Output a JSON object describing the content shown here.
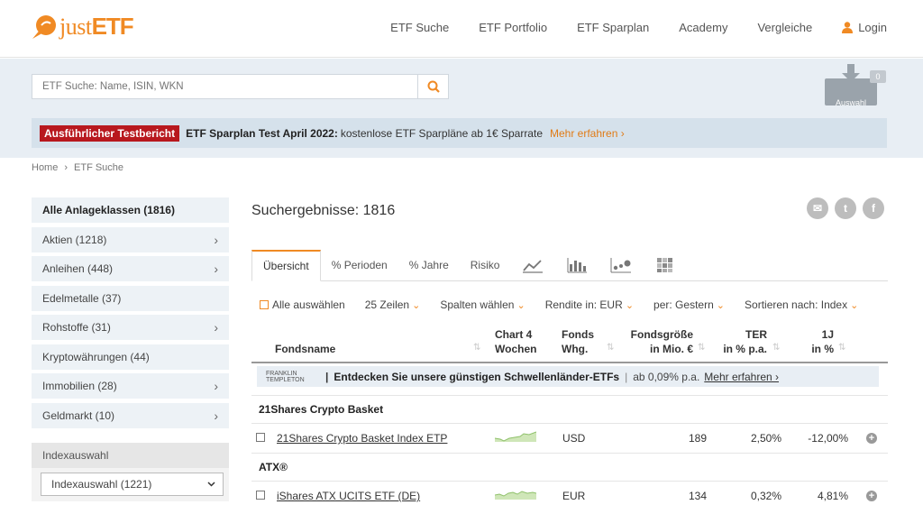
{
  "header": {
    "logo": "justETF",
    "nav": [
      "ETF Suche",
      "ETF Portfolio",
      "ETF Sparplan",
      "Academy",
      "Vergleiche"
    ],
    "login_label": "Login"
  },
  "search": {
    "placeholder": "ETF Suche: Name, ISIN, WKN"
  },
  "auswahl": {
    "label": "Auswahl",
    "count": "0"
  },
  "promo": {
    "badge": "Ausführlicher Testbericht",
    "bold": "ETF Sparplan Test April 2022:",
    "text": "kostenlose ETF Sparpläne ab 1€ Sparrate",
    "link": "Mehr erfahren ›"
  },
  "breadcrumb": [
    "Home",
    "›",
    "ETF Suche"
  ],
  "sidebar": {
    "items": [
      {
        "label": "Alle Anlageklassen (1816)",
        "chevron": ""
      },
      {
        "label": "Aktien (1218)",
        "chevron": "›"
      },
      {
        "label": "Anleihen (448)",
        "chevron": "›"
      },
      {
        "label": "Edelmetalle (37)",
        "chevron": ""
      },
      {
        "label": "Rohstoffe (31)",
        "chevron": "›"
      },
      {
        "label": "Kryptowährungen (44)",
        "chevron": ""
      },
      {
        "label": "Immobilien (28)",
        "chevron": "›"
      },
      {
        "label": "Geldmarkt (10)",
        "chevron": "›"
      }
    ],
    "index_heading": "Indexauswahl",
    "index_select": "Indexauswahl (1221)"
  },
  "results": {
    "title": "Suchergebnisse: 1816"
  },
  "tabs": [
    "Übersicht",
    "% Perioden",
    "% Jahre",
    "Risiko"
  ],
  "toolbar": {
    "select_all": "Alle auswählen",
    "rows": "25 Zeilen",
    "columns": "Spalten wählen",
    "return_in": "Rendite in: EUR",
    "per": "per: Gestern",
    "sort": "Sortieren nach: Index"
  },
  "table": {
    "headers": {
      "name": "Fondsname",
      "chart": [
        "Chart 4",
        "Wochen"
      ],
      "currency": [
        "Fonds",
        "Whg."
      ],
      "size": [
        "Fondsgröße",
        "in Mio. €"
      ],
      "ter": [
        "TER",
        "in % p.a."
      ],
      "oney": [
        "1J",
        "in %"
      ]
    },
    "banner": {
      "logo": [
        "FRANKLIN",
        "TEMPLETON"
      ],
      "bold": "Entdecken Sie unsere günstigen Schwellenländer-ETFs",
      "sep": "|",
      "text": "ab 0,09% p.a.",
      "link": "Mehr erfahren ›"
    },
    "groups": [
      {
        "title": "21Shares Crypto Basket",
        "row": {
          "name": "21Shares Crypto Basket Index ETP",
          "currency": "USD",
          "size": "189",
          "ter": "2,50%",
          "oney": "-12,00%"
        }
      },
      {
        "title": "ATX®",
        "row": {
          "name": "iShares ATX UCITS ETF (DE)",
          "currency": "EUR",
          "size": "134",
          "ter": "0,32%",
          "oney": "4,81%"
        }
      }
    ]
  },
  "colors": {
    "brand": "#f08a24",
    "badge": "#b8181e",
    "band": "#e8eef4"
  }
}
